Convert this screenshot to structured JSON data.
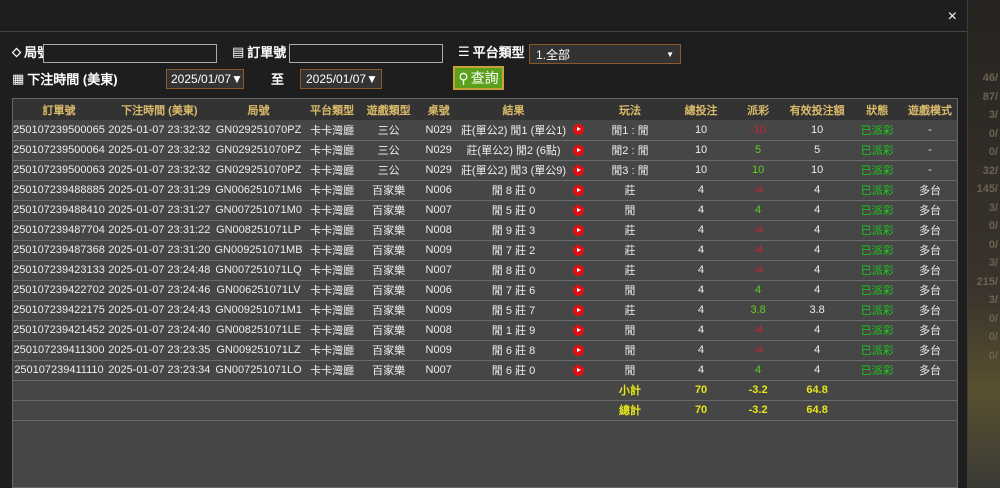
{
  "filters": {
    "round_label": "局號",
    "round_value": "",
    "order_label": "訂單號",
    "order_value": "",
    "platform_label": "平台類型",
    "platform_value": "1.全部",
    "time_label": "下注時間 (美東)",
    "date_from": "2025/01/07▼",
    "to_label": "至",
    "date_to": "2025/01/07▼",
    "query_label": "查詢"
  },
  "close": "×",
  "bg_numbers": [
    "46/",
    "87/",
    "3/",
    "0/",
    "0/",
    "32/",
    "145/",
    "3/",
    "0/",
    "0/",
    "3/",
    "215/",
    "3/",
    "0/",
    "0/",
    "0/"
  ],
  "headers": [
    "訂單號",
    "下注時間 (美東)",
    "局號",
    "平台類型",
    "遊戲類型",
    "桌號",
    "結果",
    "",
    "玩法",
    "總投注",
    "派彩",
    "有效投注額",
    "狀態",
    "遊戲模式"
  ],
  "rows": [
    [
      "250107239500065",
      "2025-01-07 23:32:32",
      "GN029251070PZ",
      "卡卡灣廳",
      "三公",
      "N029",
      "莊(單公2) 閒1 (單公1)",
      "閒1 : 閒",
      "10",
      "-10",
      "10",
      "已派彩",
      "-"
    ],
    [
      "250107239500064",
      "2025-01-07 23:32:32",
      "GN029251070PZ",
      "卡卡灣廳",
      "三公",
      "N029",
      "莊(單公2) 閒2 (6點)",
      "閒2 : 閒",
      "10",
      "5",
      "5",
      "已派彩",
      "-"
    ],
    [
      "250107239500063",
      "2025-01-07 23:32:32",
      "GN029251070PZ",
      "卡卡灣廳",
      "三公",
      "N029",
      "莊(單公2) 閒3 (單公9)",
      "閒3 : 閒",
      "10",
      "10",
      "10",
      "已派彩",
      "-"
    ],
    [
      "250107239488885",
      "2025-01-07 23:31:29",
      "GN006251071M6",
      "卡卡灣廳",
      "百家樂",
      "N006",
      "閒 8 莊 0",
      "莊",
      "4",
      "-4",
      "4",
      "已派彩",
      "多台"
    ],
    [
      "250107239488410",
      "2025-01-07 23:31:27",
      "GN007251071M0",
      "卡卡灣廳",
      "百家樂",
      "N007",
      "閒 5 莊 0",
      "閒",
      "4",
      "4",
      "4",
      "已派彩",
      "多台"
    ],
    [
      "250107239487704",
      "2025-01-07 23:31:22",
      "GN008251071LP",
      "卡卡灣廳",
      "百家樂",
      "N008",
      "閒 9 莊 3",
      "莊",
      "4",
      "-4",
      "4",
      "已派彩",
      "多台"
    ],
    [
      "250107239487368",
      "2025-01-07 23:31:20",
      "GN009251071MB",
      "卡卡灣廳",
      "百家樂",
      "N009",
      "閒 7 莊 2",
      "莊",
      "4",
      "-4",
      "4",
      "已派彩",
      "多台"
    ],
    [
      "250107239423133",
      "2025-01-07 23:24:48",
      "GN007251071LQ",
      "卡卡灣廳",
      "百家樂",
      "N007",
      "閒 8 莊 0",
      "莊",
      "4",
      "-4",
      "4",
      "已派彩",
      "多台"
    ],
    [
      "250107239422702",
      "2025-01-07 23:24:46",
      "GN006251071LV",
      "卡卡灣廳",
      "百家樂",
      "N006",
      "閒 7 莊 6",
      "閒",
      "4",
      "4",
      "4",
      "已派彩",
      "多台"
    ],
    [
      "250107239422175",
      "2025-01-07 23:24:43",
      "GN009251071M1",
      "卡卡灣廳",
      "百家樂",
      "N009",
      "閒 5 莊 7",
      "莊",
      "4",
      "3.8",
      "3.8",
      "已派彩",
      "多台"
    ],
    [
      "250107239421452",
      "2025-01-07 23:24:40",
      "GN008251071LE",
      "卡卡灣廳",
      "百家樂",
      "N008",
      "閒 1 莊 9",
      "閒",
      "4",
      "-4",
      "4",
      "已派彩",
      "多台"
    ],
    [
      "250107239411300",
      "2025-01-07 23:23:35",
      "GN009251071LZ",
      "卡卡灣廳",
      "百家樂",
      "N009",
      "閒 6 莊 8",
      "閒",
      "4",
      "-4",
      "4",
      "已派彩",
      "多台"
    ],
    [
      "250107239411110",
      "2025-01-07 23:23:34",
      "GN007251071LO",
      "卡卡灣廳",
      "百家樂",
      "N007",
      "閒 6 莊 0",
      "閒",
      "4",
      "4",
      "4",
      "已派彩",
      "多台"
    ]
  ],
  "subtotal": {
    "label": "小計",
    "bet": "70",
    "payout": "-3.2",
    "valid": "64.8"
  },
  "total": {
    "label": "總計",
    "bet": "70",
    "payout": "-3.2",
    "valid": "64.8"
  },
  "colors": {
    "negative": "#d0203a",
    "positive": "#5fd020",
    "status": "#1ec81e",
    "summary": "#e6e61a",
    "header_text": "#d9b96a",
    "query_button": "#5aa01a"
  }
}
